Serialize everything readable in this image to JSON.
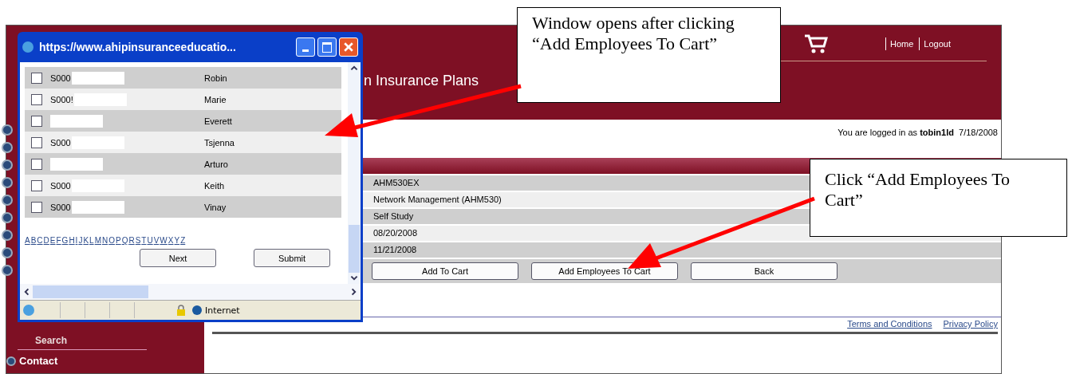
{
  "header": {
    "title": "n Insurance Plans",
    "links": [
      "Home",
      "Logout"
    ]
  },
  "login": {
    "prefix": "You are logged in as",
    "user": "tobin1ld",
    "date": "7/18/2008"
  },
  "details": [
    "AHM530EX",
    "Network Management (AHM530)",
    "Self Study",
    "08/20/2008",
    "11/21/2008"
  ],
  "actions": [
    "Add To Cart",
    "Add Employees To Cart",
    "Back"
  ],
  "footer_links": [
    "Terms and Conditions",
    "Privacy Policy"
  ],
  "sidebar": {
    "items": [
      {
        "label": "Search",
        "kind": "sub"
      },
      {
        "label": "Contact",
        "kind": "main"
      }
    ]
  },
  "popup": {
    "title": "https://www.ahipinsuranceeducatio...",
    "rows": [
      {
        "id": "S000",
        "name": "Robin",
        "checked": false
      },
      {
        "id": "S000!",
        "name": "Marie",
        "checked": false
      },
      {
        "name": "Everett",
        "checked": false
      },
      {
        "id": "S000",
        "name": "Tsjenna",
        "checked": false
      },
      {
        "name": "Arturo",
        "checked": false
      },
      {
        "id": "S000",
        "name": "Keith",
        "checked": false
      },
      {
        "id": "S000",
        "name": "Vinay",
        "checked": false
      }
    ],
    "letters": [
      "A",
      "B",
      "C",
      "D",
      "E",
      "F",
      "G",
      "H",
      "I",
      "J",
      "K",
      "L",
      "M",
      "N",
      "O",
      "P",
      "Q",
      "R",
      "S",
      "T",
      "U",
      "V",
      "W",
      "X",
      "Y",
      "Z"
    ],
    "buttons": [
      "Next",
      "Submit"
    ],
    "status": "Internet"
  },
  "callouts": [
    "Window opens after clicking “Add Employees To Cart”",
    "Click “Add Employees To Cart”"
  ]
}
